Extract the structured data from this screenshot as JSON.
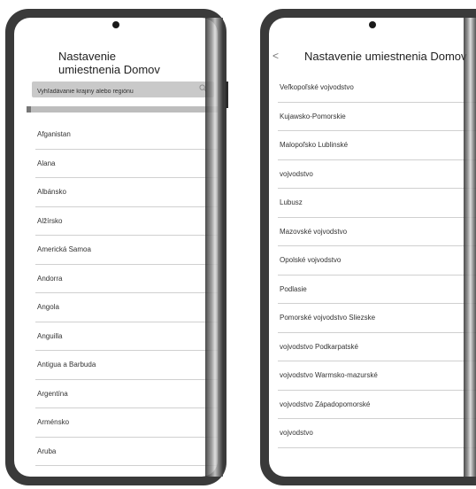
{
  "left": {
    "title": "Nastavenie\numiestnenia Domov",
    "search_placeholder": "Vyhľadávanie krajiny alebo regiónu",
    "scroll_progress_percent": 2,
    "countries": [
      "Afganistan",
      "Alana",
      "Albánsko",
      "Alžírsko",
      "Americká Samoa",
      "Andorra",
      "Angola",
      "Anguilla",
      "Antigua a Barbuda",
      "Argentína",
      "Arménsko",
      "Aruba"
    ]
  },
  "right": {
    "back_symbol": "<",
    "title": "Nastavenie umiestnenia Domov",
    "provinces": [
      "Veľkopoľské vojvodstvo",
      "Kujawsko-Pomorskie",
      "Malopoľsko Lublinské",
      "vojvodstvo",
      "Lubusz",
      "Mazovské vojvodstvo",
      "Opolské vojvodstvo",
      "Podlasie",
      "Pomorské vojvodstvo Sliezske",
      "vojvodstvo Podkarpatské",
      "vojvodstvo Warmsko-mazurské",
      "vojvodstvo Západopomorské",
      "vojvodstvo"
    ]
  },
  "icons": {
    "search": "search-icon",
    "back": "chevron-left-icon",
    "camera": "camera-icon"
  }
}
